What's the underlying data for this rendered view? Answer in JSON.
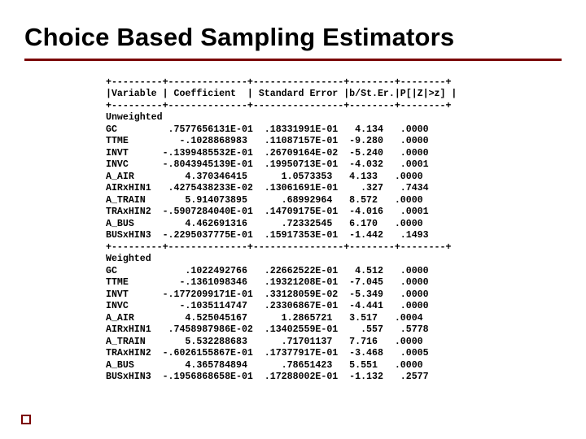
{
  "title": "Choice Based Sampling Estimators",
  "border_hdr": "+---------+--------------+----------------+--------+--------+",
  "header": "|Variable | Coefficient  | Standard Error |b/St.Er.|P[|Z|>z] |",
  "border_sep": "+---------+--------------+----------------+--------+--------+",
  "section_unw": "Unweighted",
  "unw": [
    "GC         .7577656131E-01  .18331991E-01   4.134   .0000",
    "TTME         -.1028868983   .11087157E-01  -9.280   .0000",
    "INVT      -.1399485532E-01  .26709164E-02  -5.240   .0000",
    "INVC      -.8043945139E-01  .19950713E-01  -4.032   .0001",
    "A_AIR         4.370346415      1.0573353   4.133   .0000",
    "AIRxHIN1   .4275438233E-02  .13061691E-01    .327   .7434",
    "A_TRAIN       5.914073895      .68992964   8.572   .0000",
    "TRAxHIN2  -.5907284040E-01  .14709175E-01  -4.016   .0001",
    "A_BUS         4.462691316      .72332545   6.170   .0000",
    "BUSxHIN3  -.2295037775E-01  .15917353E-01  -1.442   .1493"
  ],
  "section_w": "Weighted",
  "w": [
    "GC            .1022492766   .22662522E-01   4.512   .0000",
    "TTME         -.1361098346   .19321208E-01  -7.045   .0000",
    "INVT      -.1772099171E-01  .33128059E-02  -5.349   .0000",
    "INVC         -.1035114747   .23306867E-01  -4.441   .0000",
    "A_AIR         4.525045167      1.2865721   3.517   .0004",
    "AIRxHIN1   .7458987986E-02  .13402559E-01    .557   .5778",
    "A_TRAIN       5.532288683      .71701137   7.716   .0000",
    "TRAxHIN2  -.6026155867E-01  .17377917E-01  -3.468   .0005",
    "A_BUS         4.365784894      .78651423   5.551   .0000",
    "BUSxHIN3  -.1956868658E-01  .17288002E-01  -1.132   .2577"
  ]
}
